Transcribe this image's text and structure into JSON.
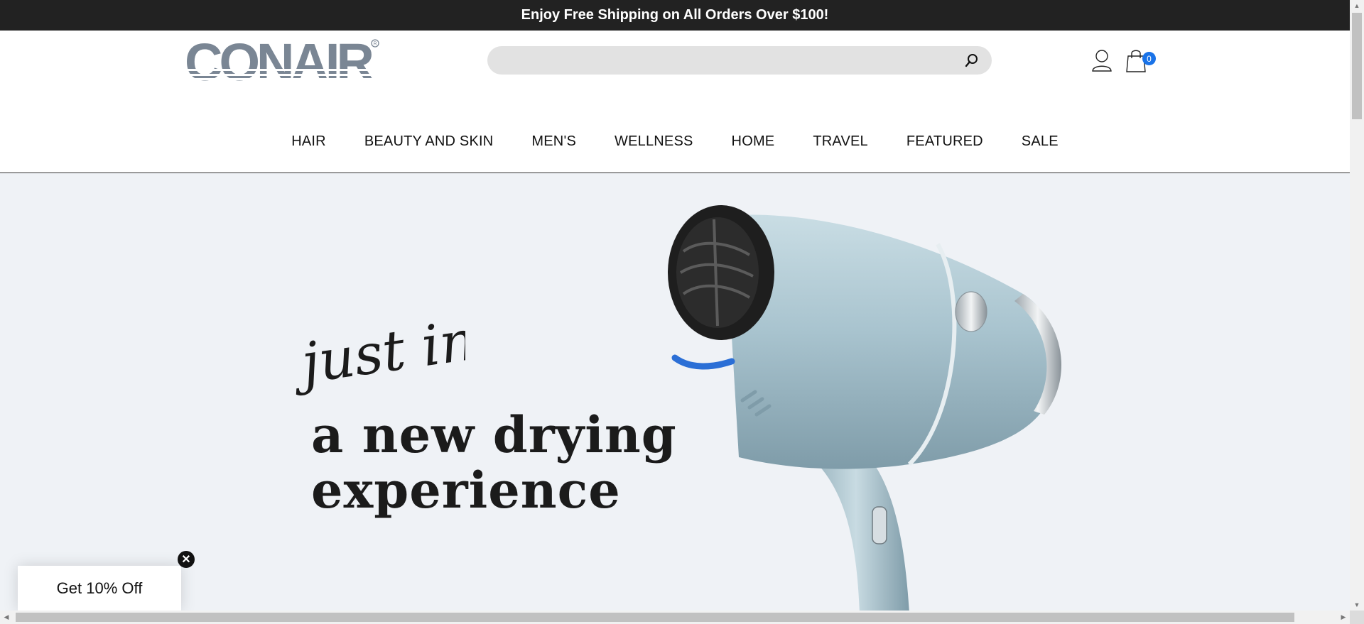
{
  "announcement": {
    "text": "Enjoy Free Shipping on All Orders Over $100!"
  },
  "header": {
    "logo_text": "CONAIR",
    "search": {
      "placeholder": "",
      "value": ""
    },
    "cart": {
      "count": "0"
    }
  },
  "nav": {
    "items": [
      {
        "label": "HAIR"
      },
      {
        "label": "BEAUTY AND SKIN"
      },
      {
        "label": "MEN'S"
      },
      {
        "label": "WELLNESS"
      },
      {
        "label": "HOME"
      },
      {
        "label": "TRAVEL"
      },
      {
        "label": "FEATURED"
      },
      {
        "label": "SALE"
      }
    ]
  },
  "hero": {
    "script_text": "just in!",
    "headline_line1": "a new drying",
    "headline_line2": "experience"
  },
  "promo": {
    "label": "Get 10% Off",
    "close_symbol": "✕"
  },
  "colors": {
    "topbar": "#222222",
    "accent": "#1a73e8",
    "hero_bg": "#eff2f6",
    "logo": "#7a8694"
  }
}
